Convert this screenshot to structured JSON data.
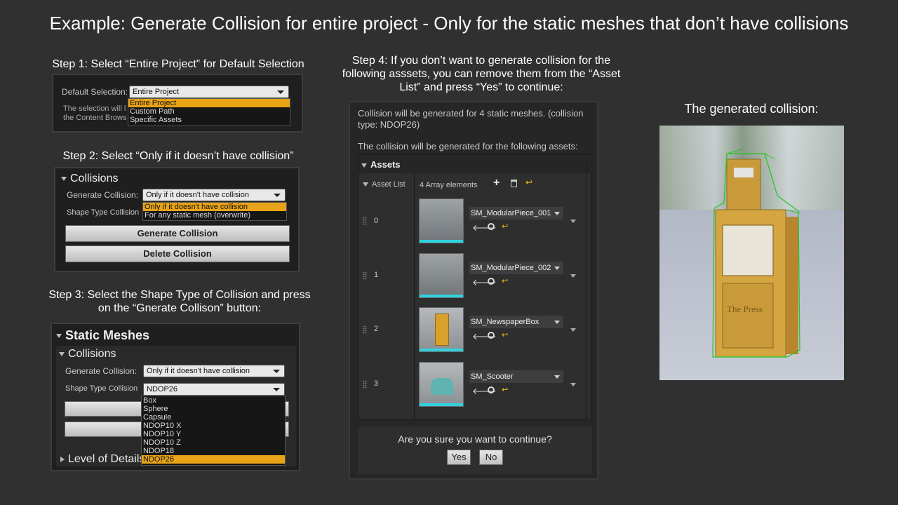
{
  "title": "Example: Generate Collision for entire project - Only for the static meshes that don’t have collisions",
  "step1": {
    "caption": "Step 1: Select “Entire Project” for Default Selection",
    "label": "Default Selection:",
    "value": "Entire Project",
    "hint_line1": "The selection will l",
    "hint_line2": "the Content Brows",
    "options": [
      "Entire Project",
      "Custom Path",
      "Specific Assets"
    ]
  },
  "step2": {
    "caption": "Step 2: Select “Only if it doesn’t have collision”",
    "section": "Collisions",
    "gen_label": "Generate Collision:",
    "gen_value": "Only if it doesn't have collision",
    "shape_label": "Shape Type Collision",
    "options": [
      "Only if it doesn't have collision",
      "For any static mesh (overwrite)"
    ],
    "btn_generate": "Generate Collision",
    "btn_delete": "Delete Collision"
  },
  "step3": {
    "caption_line1": "Step 3: Select the Shape Type of Collision and press",
    "caption_line2": "on the “Gnerate Collison” button:",
    "section": "Static Meshes",
    "subsection": "Collisions",
    "gen_label": "Generate Collision:",
    "gen_value": "Only if it doesn't have collision",
    "shape_label": "Shape Type Collision",
    "shape_value": "NDOP26",
    "options": [
      "Box",
      "Sphere",
      "Capsule",
      "NDOP10 X",
      "NDOP10 Y",
      "NDOP10 Z",
      "NDOP18",
      "NDOP26"
    ],
    "lod_label": "Level of Details"
  },
  "step4": {
    "caption_line1": "Step 4: If you don’t want to generate collision for the",
    "caption_line2": "following asssets, you can remove them from the “Asset",
    "caption_line3": "List” and press “Yes” to continue:",
    "info_line1": "Collision will be generated for 4 static meshes. (collision",
    "info_line2": "type: NDOP26)",
    "info_line3": "The collision will be generated for the following assets:",
    "assets_header": "Assets",
    "asset_list_label": "Asset List",
    "array_count": "4 Array elements",
    "items": [
      {
        "index": "0",
        "name": "SM_ModularPiece_001"
      },
      {
        "index": "1",
        "name": "SM_ModularPiece_002"
      },
      {
        "index": "2",
        "name": "SM_NewspaperBox"
      },
      {
        "index": "3",
        "name": "SM_Scooter"
      }
    ],
    "question": "Are you sure you want to continue?",
    "yes": "Yes",
    "no": "No"
  },
  "result": {
    "caption": "The generated collision:",
    "box_title": "The Press"
  },
  "colors": {
    "background": "#303030",
    "accent": "#e8a317",
    "thumb_bar": "#2fd3e0",
    "collision": "#1ec81e"
  }
}
